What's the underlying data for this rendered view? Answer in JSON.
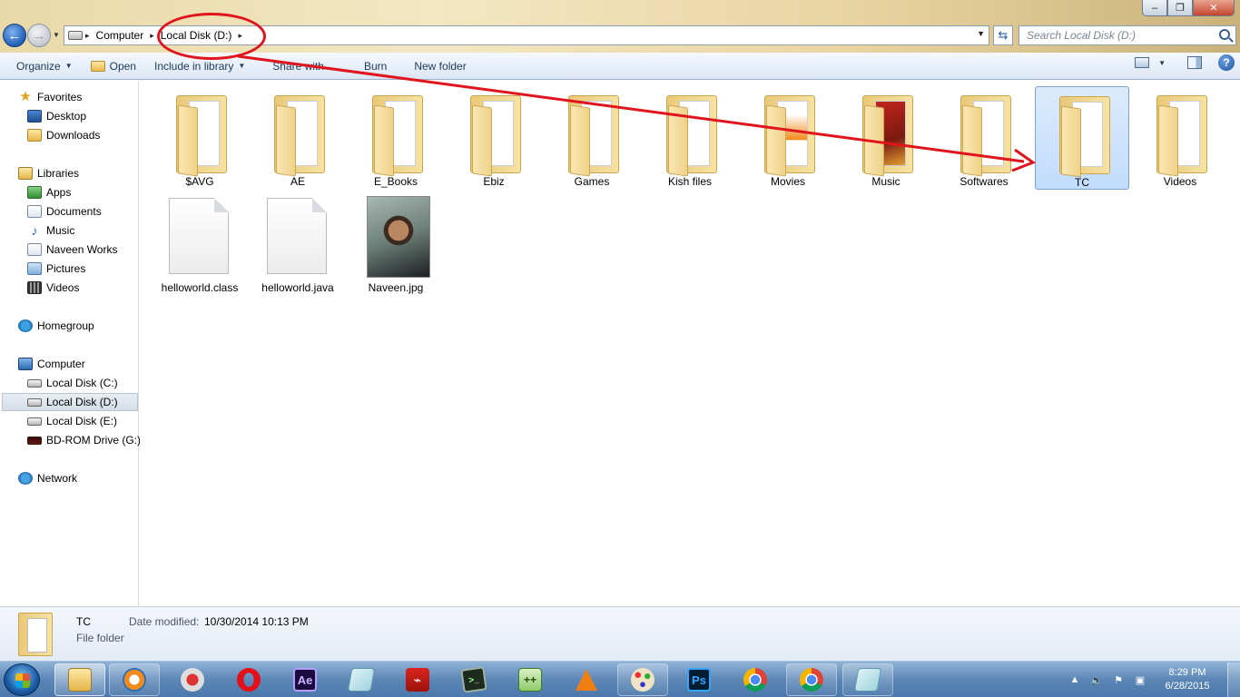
{
  "address": {
    "crumbs": [
      "Computer",
      "Local Disk (D:)"
    ]
  },
  "search": {
    "placeholder": "Search Local Disk (D:)"
  },
  "toolbar": {
    "organize": "Organize",
    "open": "Open",
    "include_in_library": "Include in library",
    "share_with": "Share with",
    "burn": "Burn",
    "new_folder": "New folder"
  },
  "navpane": {
    "favorites": "Favorites",
    "desktop": "Desktop",
    "downloads": "Downloads",
    "libraries": "Libraries",
    "apps": "Apps",
    "documents": "Documents",
    "music": "Music",
    "naveen_works": "Naveen Works",
    "pictures": "Pictures",
    "videos": "Videos",
    "homegroup": "Homegroup",
    "computer": "Computer",
    "disk_c": "Local Disk (C:)",
    "disk_d": "Local Disk (D:)",
    "disk_e": "Local Disk (E:)",
    "bd_rom": "BD-ROM Drive (G:)",
    "network": "Network"
  },
  "items": [
    {
      "name": "$AVG",
      "type": "folder"
    },
    {
      "name": "AE",
      "type": "folder"
    },
    {
      "name": "E_Books",
      "type": "folder"
    },
    {
      "name": "Ebiz",
      "type": "folder"
    },
    {
      "name": "Games",
      "type": "folder"
    },
    {
      "name": "Kish files",
      "type": "folder"
    },
    {
      "name": "Movies",
      "type": "folder"
    },
    {
      "name": "Music",
      "type": "folder"
    },
    {
      "name": "Softwares",
      "type": "folder"
    },
    {
      "name": "TC",
      "type": "folder",
      "selected": true
    },
    {
      "name": "Videos",
      "type": "folder"
    },
    {
      "name": "helloworld.class",
      "type": "file"
    },
    {
      "name": "helloworld.java",
      "type": "file"
    },
    {
      "name": "Naveen.jpg",
      "type": "image"
    }
  ],
  "details": {
    "name": "TC",
    "type": "File folder",
    "modified_label": "Date modified:",
    "modified_value": "10/30/2014 10:13 PM"
  },
  "taskbar": {
    "apps": [
      "explorer",
      "windows-media-player",
      "snipping-tool",
      "opera",
      "after-effects",
      "sticky-glass",
      "adobe-reader",
      "command-prompt",
      "notepad-plus-plus",
      "vlc",
      "paint",
      "photoshop",
      "chrome",
      "chrome-app",
      "sticky-glass-2"
    ],
    "ae_label": "Ae",
    "ps_label": "Ps"
  },
  "clock": {
    "time": "8:29 PM",
    "date": "6/28/2015"
  },
  "colors": {
    "annotation_red": "#e0141c",
    "accent_blue": "#1e395b"
  }
}
